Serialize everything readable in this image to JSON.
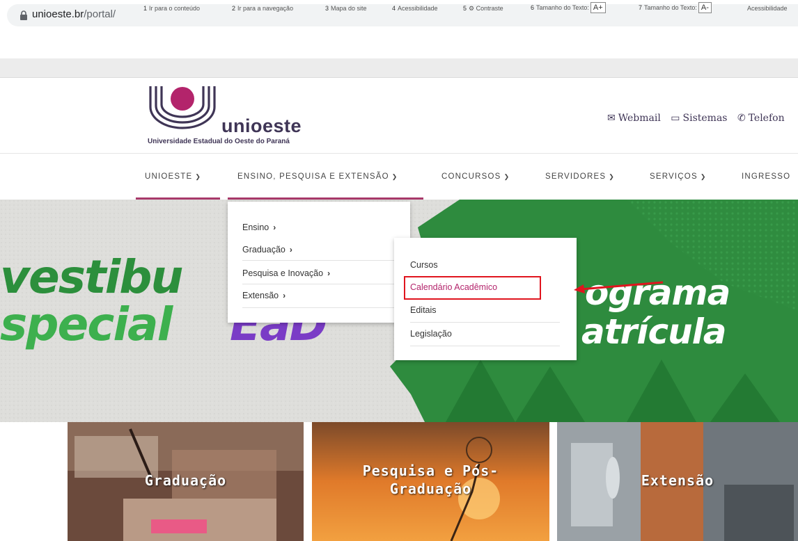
{
  "browser": {
    "url_domain": "unioeste.br",
    "url_path": "/portal/"
  },
  "accessibility_bar": {
    "items": [
      {
        "num": "1",
        "label": "Ir para o conteúdo"
      },
      {
        "num": "2",
        "label": "Ir para a navegação"
      },
      {
        "num": "3",
        "label": "Mapa do site"
      },
      {
        "num": "4",
        "label": "Acessibilidade"
      },
      {
        "num": "5",
        "label": "Contraste"
      },
      {
        "num": "6",
        "label": "Tamanho do Texto:",
        "box": "A+"
      },
      {
        "num": "7",
        "label": "Tamanho do Texto:",
        "box": "A-"
      },
      {
        "num": "",
        "label": "Acessibilidade"
      }
    ]
  },
  "header": {
    "logo_word": "unioeste",
    "logo_subtitle": "Universidade Estadual do Oeste do Paraná",
    "links": [
      "Webmail",
      "Sistemas",
      "Telefon"
    ]
  },
  "nav": {
    "items": [
      "UNIOESTE",
      "ENSINO, PESQUISA E EXTENSÃO",
      "CONCURSOS",
      "SERVIDORES",
      "SERVIÇOS",
      "INGRESSO"
    ]
  },
  "dropdown_level1": {
    "items": [
      "Ensino",
      "Graduação",
      "Pesquisa e Inovação",
      "Extensão"
    ]
  },
  "dropdown_level2": {
    "items": [
      "Cursos",
      "Calendário Acadêmico",
      "Editais",
      "Legislação"
    ]
  },
  "banner": {
    "left_line1": "vestibu",
    "left_line2": "special",
    "left_ead": "EaD",
    "right_line1": "ograma",
    "right_line2": "atrícula"
  },
  "cards": {
    "graduacao": "Graduação",
    "pesquisa_line1": "Pesquisa e Pós-",
    "pesquisa_line2": "Graduação",
    "extensao": "Extensão"
  },
  "colors": {
    "brand_purple": "#3f3556",
    "brand_magenta": "#b3246b",
    "highlight_red": "#e0141e",
    "banner_green": "#2e8b3e"
  }
}
